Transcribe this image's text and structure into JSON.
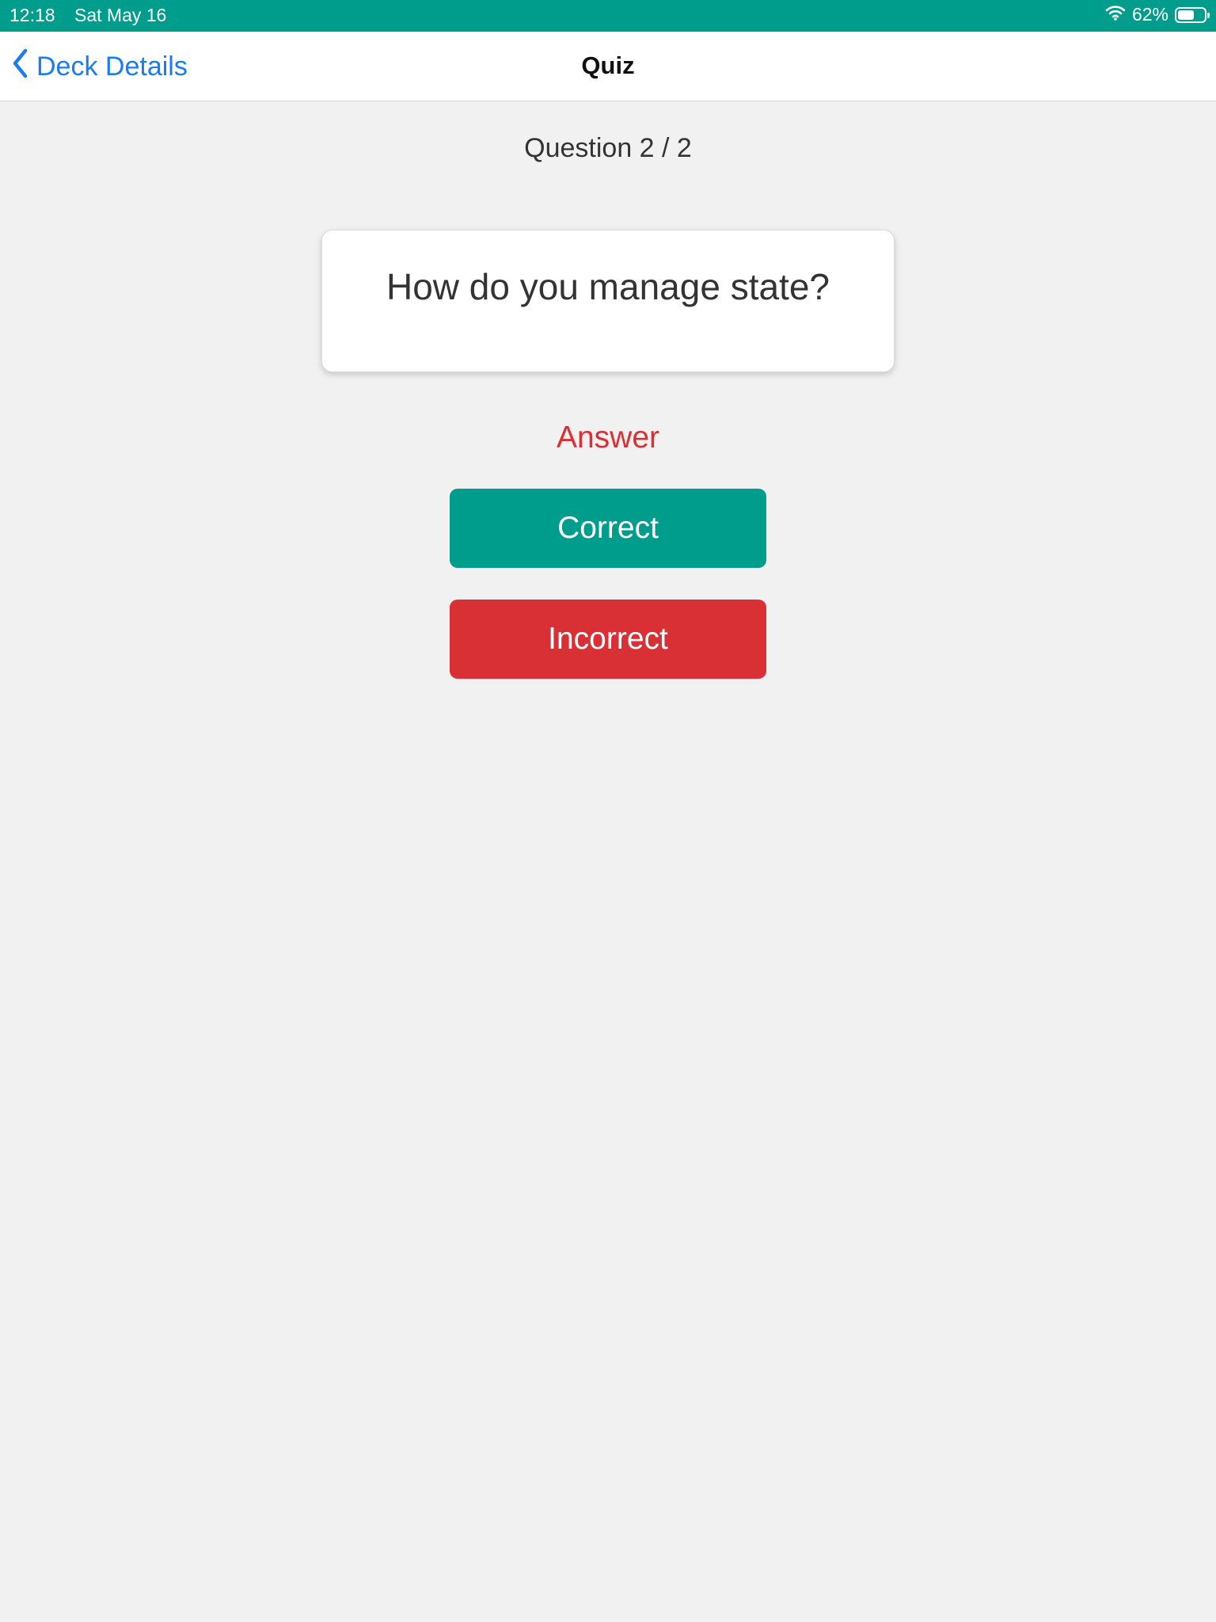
{
  "status_bar": {
    "time": "12:18",
    "date": "Sat May 16",
    "battery_percent": "62%",
    "battery_level": 0.62
  },
  "nav": {
    "back_label": "Deck Details",
    "title": "Quiz"
  },
  "quiz": {
    "counter": "Question 2 / 2",
    "question": "How do you manage state?",
    "answer_label": "Answer",
    "correct_label": "Correct",
    "incorrect_label": "Incorrect"
  },
  "colors": {
    "accent": "#009c8c",
    "danger": "#d93036",
    "link": "#1a7cf0",
    "background": "#f1f1f1"
  },
  "icons": [
    "wifi-icon",
    "battery-icon",
    "chevron-left-icon"
  ]
}
